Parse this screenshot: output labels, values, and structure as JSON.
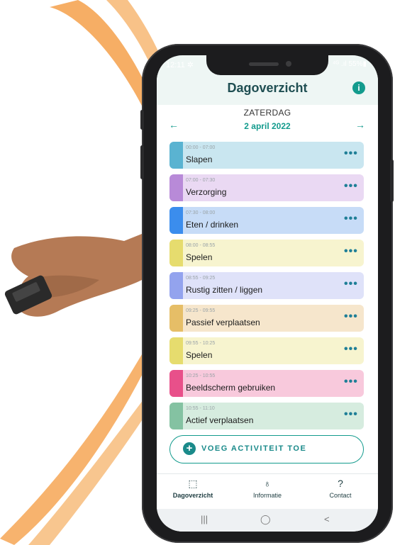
{
  "status_bar": {
    "time": "12:11 ✲",
    "right": "⁴ᴳ .ıl 55%▮"
  },
  "header": {
    "title": "Dagoverzicht",
    "info_icon": "i"
  },
  "date_nav": {
    "day": "ZATERDAG",
    "date": "2 april 2022",
    "prev_icon": "←",
    "next_icon": "→"
  },
  "activities": [
    {
      "time": "00:00 - 07:00",
      "name": "Slapen",
      "color": "#5ab3d1",
      "bg": "#c9e6f0"
    },
    {
      "time": "07:00 - 07:30",
      "name": "Verzorging",
      "color": "#b88ad8",
      "bg": "#ead9f3"
    },
    {
      "time": "07:30 - 08:00",
      "name": "Eten / drinken",
      "color": "#3b8ded",
      "bg": "#c7dcf7"
    },
    {
      "time": "08:00 - 08:55",
      "name": "Spelen",
      "color": "#e6dc6e",
      "bg": "#f7f4cf"
    },
    {
      "time": "08:55 - 09:25",
      "name": "Rustig zitten / liggen",
      "color": "#93a3ee",
      "bg": "#dfe2f9"
    },
    {
      "time": "09:25 - 09:55",
      "name": "Passief verplaatsen",
      "color": "#e6be67",
      "bg": "#f6e6cc"
    },
    {
      "time": "09:55 - 10:25",
      "name": "Spelen",
      "color": "#e6dc6e",
      "bg": "#f7f4cf"
    },
    {
      "time": "10:25 - 10:55",
      "name": "Beeldscherm gebruiken",
      "color": "#e8508a",
      "bg": "#f8c9dc"
    },
    {
      "time": "10:55 - 11:10",
      "name": "Actief verplaatsen",
      "color": "#84c2a2",
      "bg": "#d6ecdf"
    }
  ],
  "more_icon": "•••",
  "add_button": {
    "icon": "+",
    "label": "VOEG ACTIVITEIT TOE"
  },
  "tabs": [
    {
      "icon": "⬚",
      "label": "Dagoverzicht"
    },
    {
      "icon": "♁",
      "label": "Informatie"
    },
    {
      "icon": "?",
      "label": "Contact"
    }
  ],
  "android_nav": {
    "recents": "|||",
    "home": "◯",
    "back": "<"
  },
  "colors": {
    "accent": "#139b8d",
    "title": "#1f4e52",
    "dots": "#1f7f97"
  }
}
